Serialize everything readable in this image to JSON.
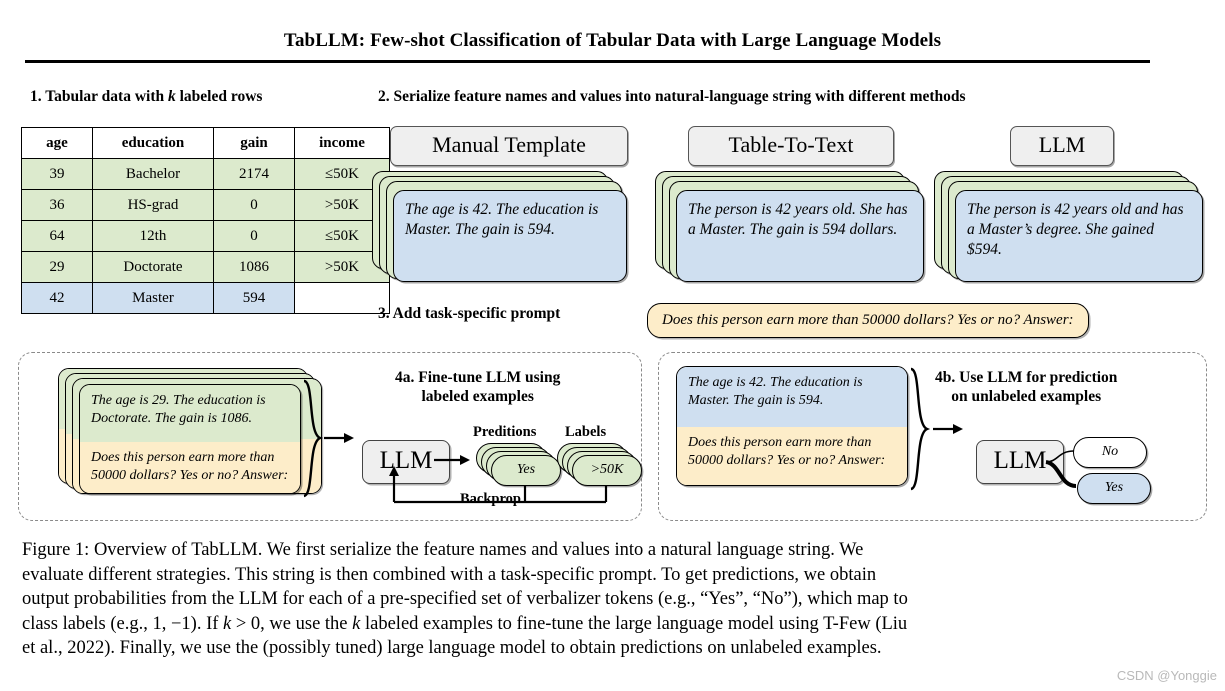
{
  "paper": {
    "title": "TabLLM: Few-shot Classification of Tabular Data with Large Language Models"
  },
  "steps": {
    "step1_prefix": "1. Tabular data with ",
    "step1_italic": "k",
    "step1_suffix": " labeled rows",
    "step2": "2. Serialize feature names and values into natural-language string with different methods",
    "step3": "3. Add task-specific prompt",
    "step4a_line1": "4a. Fine-tune LLM using",
    "step4a_line2": "labeled examples",
    "step4b_line1": "4b. Use LLM for prediction",
    "step4b_line2": "on unlabeled examples"
  },
  "table": {
    "headers": [
      "age",
      "education",
      "gain",
      "income"
    ],
    "rows": [
      {
        "cells": [
          "39",
          "Bachelor",
          "2174",
          "≤50K"
        ],
        "kind": "labeled"
      },
      {
        "cells": [
          "36",
          "HS-grad",
          "0",
          ">50K"
        ],
        "kind": "labeled"
      },
      {
        "cells": [
          "64",
          "12th",
          "0",
          "≤50K"
        ],
        "kind": "labeled"
      },
      {
        "cells": [
          "29",
          "Doctorate",
          "1086",
          ">50K"
        ],
        "kind": "labeled"
      },
      {
        "cells": [
          "42",
          "Master",
          "594",
          ""
        ],
        "kind": "unlabeled"
      }
    ]
  },
  "serializations": [
    {
      "method_label": "Manual Template",
      "text": "The age is 42. The education is Master. The gain is 594."
    },
    {
      "method_label": "Table-To-Text",
      "text": "The person is 42 years old. She has a Master. The gain is 594 dollars."
    },
    {
      "method_label": "LLM",
      "text": "The person is 42 years old and has a Master’s degree. She gained $594."
    }
  ],
  "prompt": {
    "text": "Does this person earn more than 50000 dollars? Yes or no? Answer:"
  },
  "finetune": {
    "example_card": {
      "serialized": "The age is 29. The education is Doctorate. The gain is 1086.",
      "prompt": "Does this person earn more than 50000 dollars? Yes or no? Answer:"
    },
    "llm_label": "LLM",
    "predictions_label": "Preditions",
    "labels_label": "Labels",
    "prediction_value": "Yes",
    "label_value": ">50K",
    "backprop_label": "Backprop"
  },
  "inference": {
    "example_card": {
      "serialized": "The age is 42. The education is Master. The gain is 594.",
      "prompt": "Does this person earn more than 50000 dollars? Yes or no? Answer:"
    },
    "llm_label": "LLM",
    "options": [
      {
        "text": "No",
        "selected": false
      },
      {
        "text": "Yes",
        "selected": true
      }
    ]
  },
  "caption": {
    "line1_a": "Figure 1: Overview of TabLLM. We first serialize the feature names and values into a natural language string. We",
    "line2_a": "evaluate different strategies. This string is then combined with a task-specific prompt. To get predictions, we obtain",
    "line3_a": "output probabilities from the LLM for each of a pre-specified set of verbalizer tokens (e.g., “Yes”, “No”), which map to",
    "line4_a": "class labels (e.g., 1, −1). If ",
    "line4_k1": "k",
    "line4_b": " > 0, we use the ",
    "line4_k2": "k",
    "line4_c": " labeled examples to fine-tune the large language model using T-Few (Liu",
    "line5_a": "et al., 2022). Finally, we use the (possibly tuned) large language model to obtain predictions on unlabeled examples."
  },
  "watermark": {
    "text": "CSDN @Yonggie"
  },
  "colors": {
    "green_card": "#dceacd",
    "blue_card": "#cfdff0",
    "yellow_card": "#fdedc9",
    "chip_gray": "#efefef",
    "dashed_border": "#8a8a8a"
  }
}
